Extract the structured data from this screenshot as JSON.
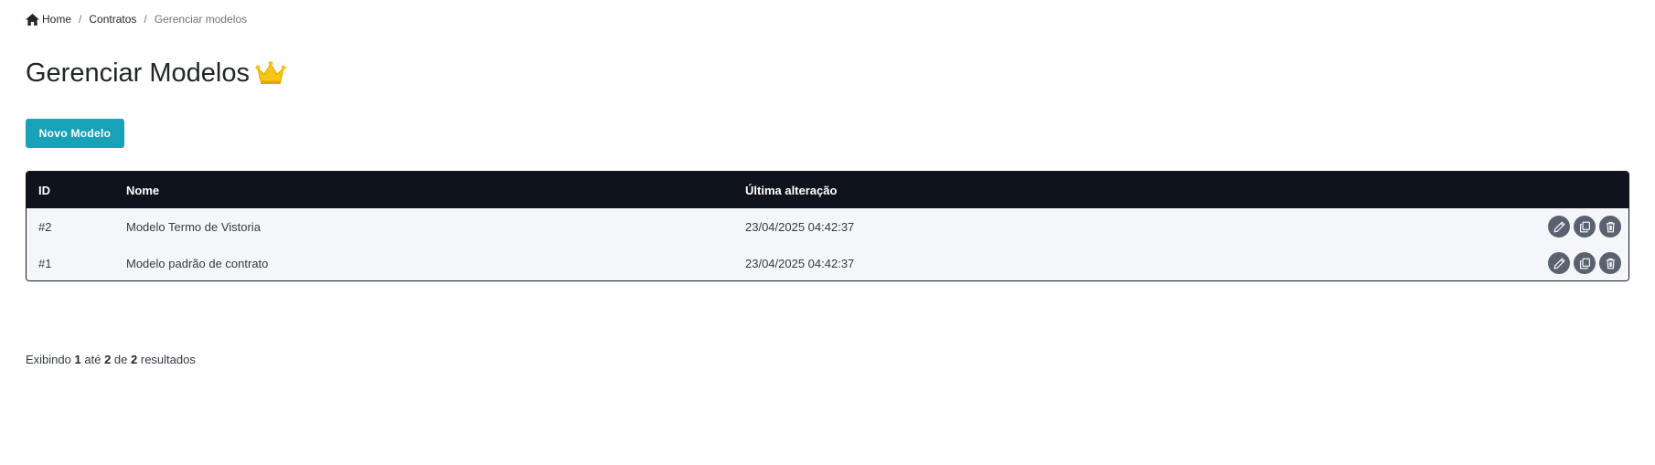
{
  "breadcrumb": {
    "home": "Home",
    "contratos": "Contratos",
    "current": "Gerenciar modelos",
    "separator": "/"
  },
  "header": {
    "title": "Gerenciar Modelos",
    "crown_icon": "crown-icon",
    "crown_color": "#f5c518"
  },
  "toolbar": {
    "new_button_label": "Novo Modelo",
    "accent_color": "#17a2b8"
  },
  "table": {
    "columns": {
      "id": "ID",
      "nome": "Nome",
      "ultima_alteracao": "Última alteração"
    },
    "rows": [
      {
        "id": "#2",
        "nome": "Modelo Termo de Vistoria",
        "data": "23/04/2025 04:42:37"
      },
      {
        "id": "#1",
        "nome": "Modelo padrão de contrato",
        "data": "23/04/2025 04:42:37"
      }
    ],
    "row_actions": [
      "edit-icon",
      "copy-icon",
      "trash-icon"
    ]
  },
  "pagination": {
    "prefix": "Exibindo",
    "from": "1",
    "to_word": "até",
    "to": "2",
    "of_word": "de",
    "total": "2",
    "suffix": "resultados"
  }
}
